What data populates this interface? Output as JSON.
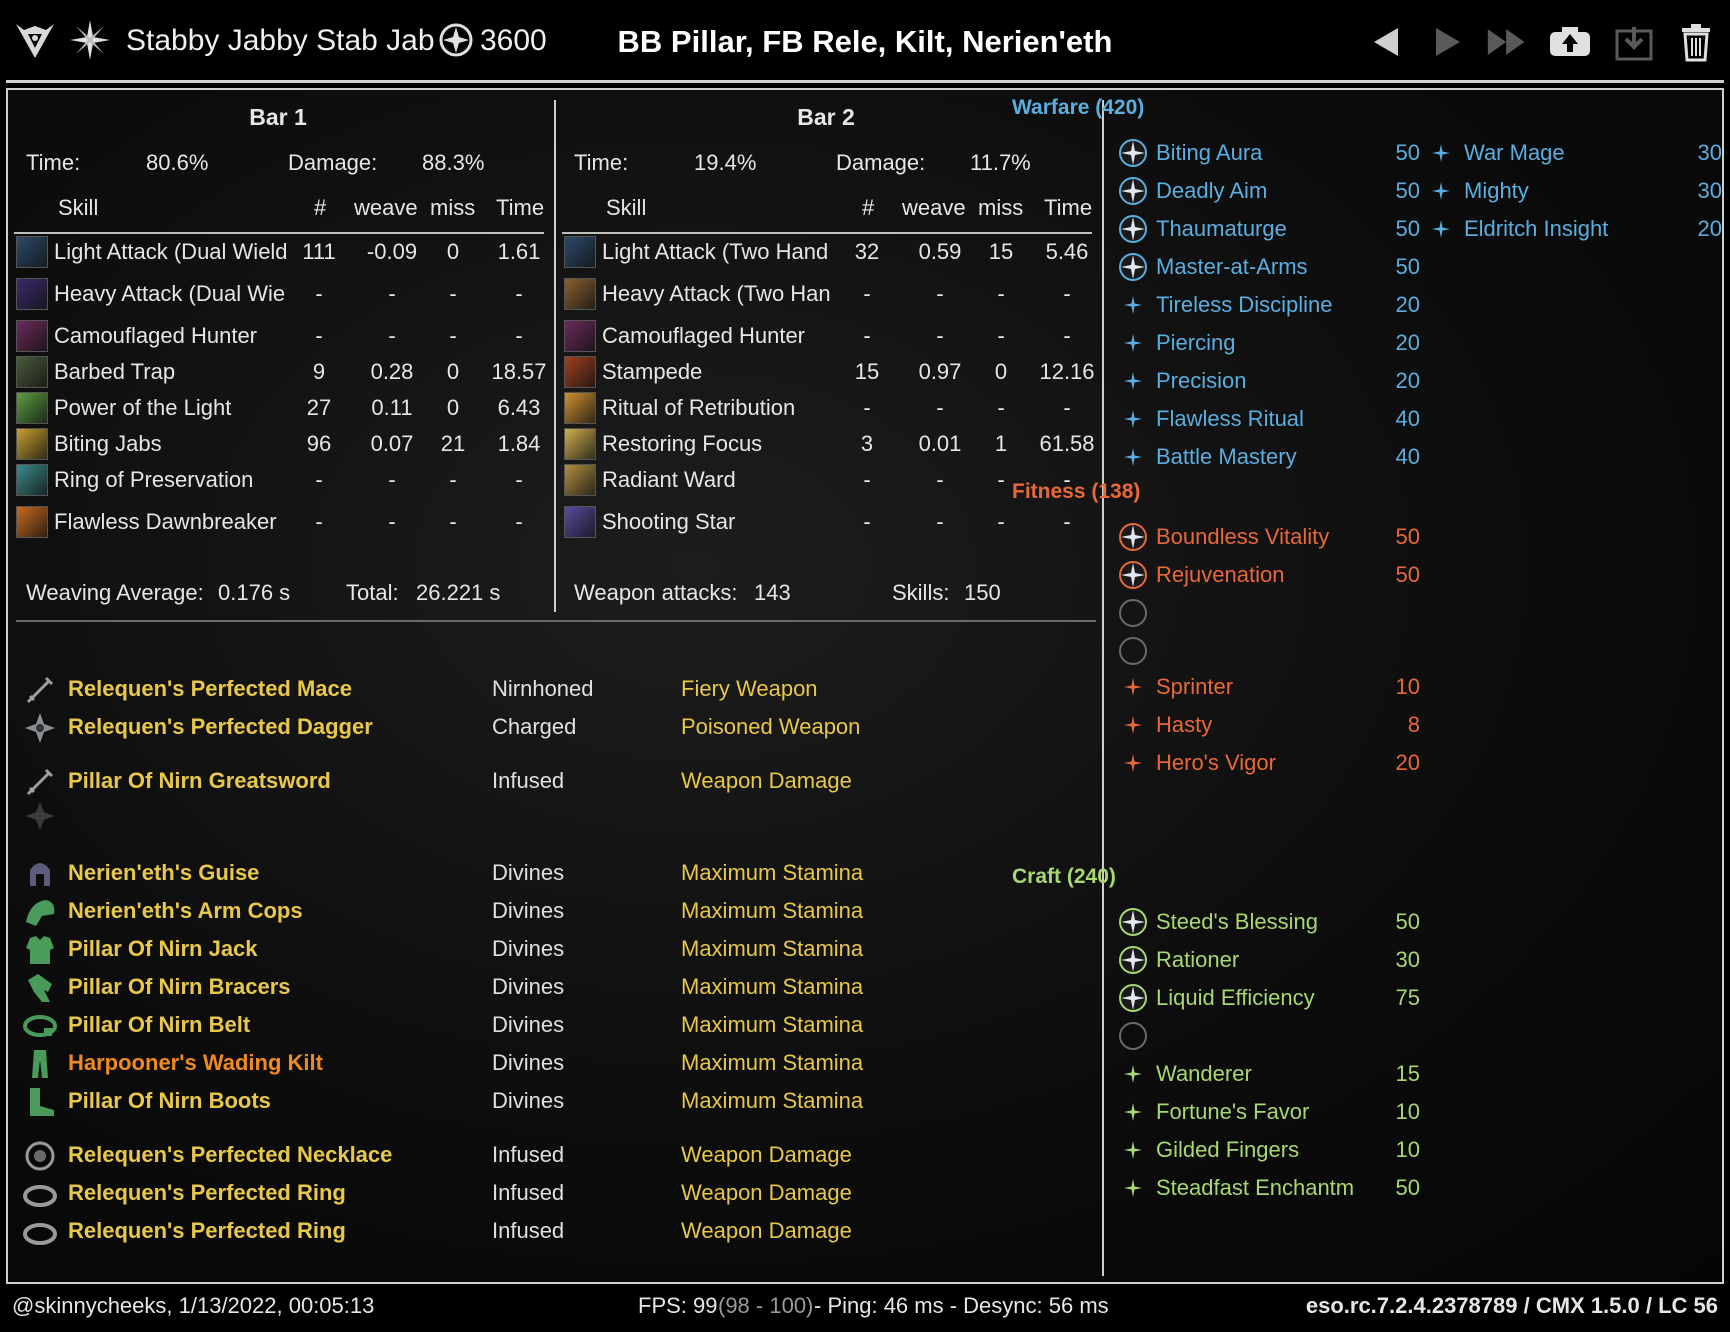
{
  "header": {
    "character_name": "Stabby Jabby Stab Jab",
    "cp_value": "3600",
    "title": "BB Pillar, FB Rele, Kilt, Nerien'eth"
  },
  "bar1": {
    "title": "Bar 1",
    "time_label": "Time:",
    "time_value": "80.6%",
    "damage_label": "Damage:",
    "damage_value": "88.3%",
    "columns": {
      "skill": "Skill",
      "count": "#",
      "weave": "weave",
      "miss": "miss",
      "time": "Time"
    },
    "skills": [
      {
        "name": "Light Attack (Dual Wield",
        "count": "111",
        "weave": "-0.09",
        "miss": "0",
        "time": "1.61",
        "icon_color": "#2c4a6a"
      },
      {
        "name": "Heavy Attack (Dual Wie",
        "count": "-",
        "weave": "-",
        "miss": "-",
        "time": "-",
        "icon_color": "#3a2a6a"
      },
      {
        "name": "Camouflaged Hunter",
        "count": "-",
        "weave": "-",
        "miss": "-",
        "time": "-",
        "icon_color": "#6a2a5a"
      },
      {
        "name": "Barbed Trap",
        "count": "9",
        "weave": "0.28",
        "miss": "0",
        "time": "18.57",
        "icon_color": "#4a5a3a"
      },
      {
        "name": "Power of the Light",
        "count": "27",
        "weave": "0.11",
        "miss": "0",
        "time": "6.43",
        "icon_color": "#5aa040"
      },
      {
        "name": "Biting Jabs",
        "count": "96",
        "weave": "0.07",
        "miss": "21",
        "time": "1.84",
        "icon_color": "#c8a030"
      },
      {
        "name": "Ring of Preservation",
        "count": "-",
        "weave": "-",
        "miss": "-",
        "time": "-",
        "icon_color": "#3a8a8a"
      },
      {
        "name": "Flawless Dawnbreaker",
        "count": "-",
        "weave": "-",
        "miss": "-",
        "time": "-",
        "icon_color": "#c86a20"
      }
    ],
    "weaving_label": "Weaving Average:",
    "weaving_value": "0.176 s",
    "total_label": "Total:",
    "total_value": "26.221 s"
  },
  "bar2": {
    "title": "Bar 2",
    "time_label": "Time:",
    "time_value": "19.4%",
    "damage_label": "Damage:",
    "damage_value": "11.7%",
    "columns": {
      "skill": "Skill",
      "count": "#",
      "weave": "weave",
      "miss": "miss",
      "time": "Time"
    },
    "skills": [
      {
        "name": "Light Attack (Two Hand",
        "count": "32",
        "weave": "0.59",
        "miss": "15",
        "time": "5.46",
        "icon_color": "#2c4a6a"
      },
      {
        "name": "Heavy Attack (Two Han",
        "count": "-",
        "weave": "-",
        "miss": "-",
        "time": "-",
        "icon_color": "#8a6030"
      },
      {
        "name": "Camouflaged Hunter",
        "count": "-",
        "weave": "-",
        "miss": "-",
        "time": "-",
        "icon_color": "#6a2a5a"
      },
      {
        "name": "Stampede",
        "count": "15",
        "weave": "0.97",
        "miss": "0",
        "time": "12.16",
        "icon_color": "#a04020"
      },
      {
        "name": "Ritual of Retribution",
        "count": "-",
        "weave": "-",
        "miss": "-",
        "time": "-",
        "icon_color": "#d09030"
      },
      {
        "name": "Restoring Focus",
        "count": "3",
        "weave": "0.01",
        "miss": "1",
        "time": "61.58",
        "icon_color": "#d0b050"
      },
      {
        "name": "Radiant Ward",
        "count": "-",
        "weave": "-",
        "miss": "-",
        "time": "-",
        "icon_color": "#b09040"
      },
      {
        "name": "Shooting Star",
        "count": "-",
        "weave": "-",
        "miss": "-",
        "time": "-",
        "icon_color": "#5a4aa0"
      }
    ],
    "weapon_label": "Weapon attacks:",
    "weapon_value": "143",
    "skills_label": "Skills:",
    "skills_value": "150"
  },
  "equipment": [
    {
      "name": "Relequen's Perfected Mace",
      "trait": "Nirnhoned",
      "enchant": "Fiery Weapon",
      "color": "#e8c84a",
      "icon": "sword-icon"
    },
    {
      "name": "Relequen's Perfected Dagger",
      "trait": "Charged",
      "enchant": "Poisoned Weapon",
      "color": "#e8c84a",
      "icon": "gear-icon"
    },
    {
      "name": "Pillar Of Nirn Greatsword",
      "trait": "Infused",
      "enchant": "Weapon Damage",
      "color": "#e8c84a",
      "icon": "sword-icon"
    },
    {
      "name": "",
      "trait": "",
      "enchant": "",
      "color": "#e8c84a",
      "icon": "empty-slot-icon"
    },
    {
      "name": "Nerien'eth's Guise",
      "trait": "Divines",
      "enchant": "Maximum Stamina",
      "color": "#e8c84a",
      "icon": "helmet-icon"
    },
    {
      "name": "Nerien'eth's Arm Cops",
      "trait": "Divines",
      "enchant": "Maximum Stamina",
      "color": "#e8c84a",
      "icon": "shoulder-icon"
    },
    {
      "name": "Pillar Of Nirn Jack",
      "trait": "Divines",
      "enchant": "Maximum Stamina",
      "color": "#e8c84a",
      "icon": "chest-icon"
    },
    {
      "name": "Pillar Of Nirn Bracers",
      "trait": "Divines",
      "enchant": "Maximum Stamina",
      "color": "#e8c84a",
      "icon": "gloves-icon"
    },
    {
      "name": "Pillar Of Nirn Belt",
      "trait": "Divines",
      "enchant": "Maximum Stamina",
      "color": "#e8c84a",
      "icon": "belt-icon"
    },
    {
      "name": "Harpooner's Wading Kilt",
      "trait": "Divines",
      "enchant": "Maximum Stamina",
      "color": "#f08a20",
      "icon": "legs-icon"
    },
    {
      "name": "Pillar Of Nirn Boots",
      "trait": "Divines",
      "enchant": "Maximum Stamina",
      "color": "#e8c84a",
      "icon": "boots-icon"
    },
    {
      "name": "Relequen's Perfected Necklace",
      "trait": "Infused",
      "enchant": "Weapon Damage",
      "color": "#e8c84a",
      "icon": "necklace-icon"
    },
    {
      "name": "Relequen's Perfected Ring",
      "trait": "Infused",
      "enchant": "Weapon Damage",
      "color": "#e8c84a",
      "icon": "ring-icon"
    },
    {
      "name": "Relequen's Perfected Ring",
      "trait": "Infused",
      "enchant": "Weapon Damage",
      "color": "#e8c84a",
      "icon": "ring-icon"
    }
  ],
  "warfare": {
    "title": "Warfare (420)",
    "color": "#5aaee0",
    "slotted": [
      {
        "name": "Biting Aura",
        "value": "50"
      },
      {
        "name": "Deadly Aim",
        "value": "50"
      },
      {
        "name": "Thaumaturge",
        "value": "50"
      },
      {
        "name": "Master-at-Arms",
        "value": "50"
      }
    ],
    "passive": [
      {
        "name": "Tireless Discipline",
        "value": "20"
      },
      {
        "name": "Piercing",
        "value": "20"
      },
      {
        "name": "Precision",
        "value": "20"
      },
      {
        "name": "Flawless Ritual",
        "value": "40"
      },
      {
        "name": "Battle Mastery",
        "value": "40"
      }
    ],
    "extra": [
      {
        "name": "War Mage",
        "value": "30"
      },
      {
        "name": "Mighty",
        "value": "30"
      },
      {
        "name": "Eldritch Insight",
        "value": "20"
      }
    ]
  },
  "fitness": {
    "title": "Fitness (138)",
    "color": "#e8683a",
    "slotted": [
      {
        "name": "Boundless Vitality",
        "value": "50"
      },
      {
        "name": "Rejuvenation",
        "value": "50"
      },
      {
        "name": "",
        "value": ""
      },
      {
        "name": "",
        "value": ""
      }
    ],
    "passive": [
      {
        "name": "Sprinter",
        "value": "10"
      },
      {
        "name": "Hasty",
        "value": "8"
      },
      {
        "name": "Hero's Vigor",
        "value": "20"
      }
    ]
  },
  "craft": {
    "title": "Craft (240)",
    "color": "#a8d870",
    "slotted": [
      {
        "name": "Steed's Blessing",
        "value": "50"
      },
      {
        "name": "Rationer",
        "value": "30"
      },
      {
        "name": "Liquid Efficiency",
        "value": "75"
      },
      {
        "name": "",
        "value": ""
      }
    ],
    "passive": [
      {
        "name": "Wanderer",
        "value": "15"
      },
      {
        "name": "Fortune's Favor",
        "value": "10"
      },
      {
        "name": "Gilded Fingers",
        "value": "10"
      },
      {
        "name": "Steadfast Enchantm",
        "value": "50"
      }
    ]
  },
  "footer": {
    "user_date": "@skinnycheeks, 1/13/2022, 00:05:13",
    "fps": "FPS: 99",
    "fps_range": "(98 - 100)",
    "ping": "- Ping: 46 ms - Desync: 56 ms",
    "version": "eso.rc.7.2.4.2378789 / CMX 1.5.0 / LC 56"
  }
}
